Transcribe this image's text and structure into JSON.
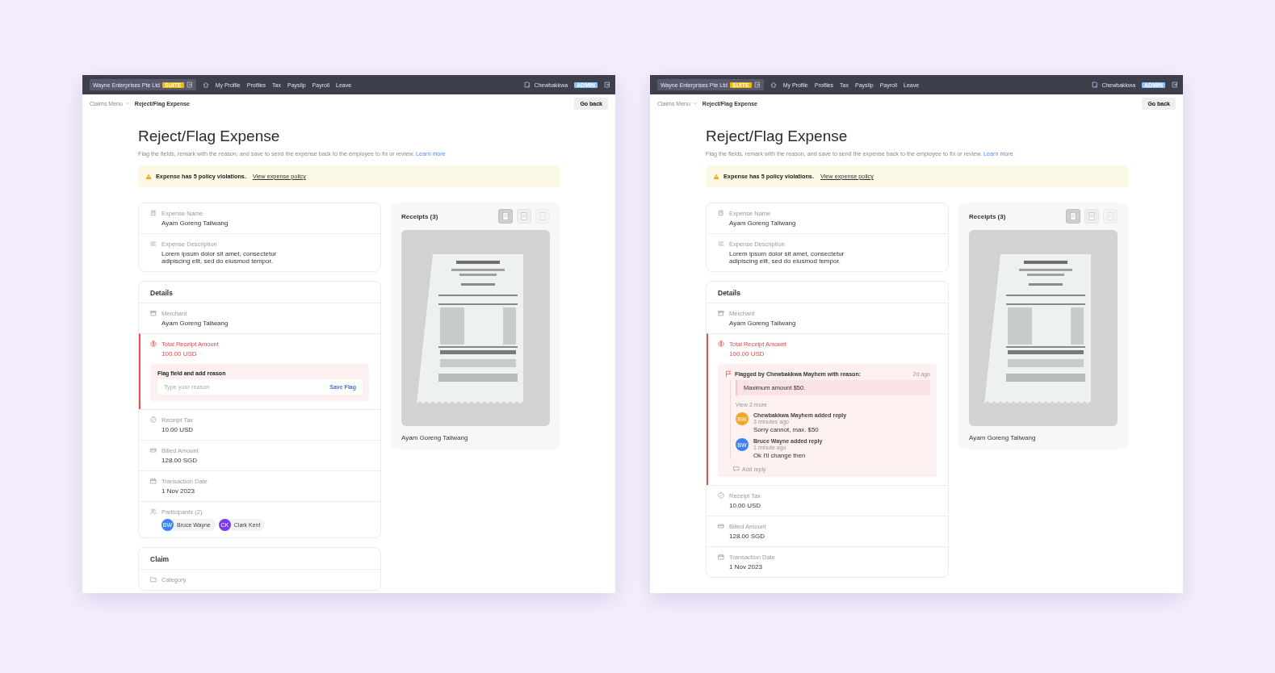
{
  "screens": [
    {
      "nav": {
        "company": "Wayne Enterprises Pte Ltd",
        "company_badge": "SUITE",
        "menu": [
          {
            "label": "My Profile"
          },
          {
            "label": "Profiles"
          },
          {
            "label": "Tax"
          },
          {
            "label": "Payslip"
          },
          {
            "label": "Payroll"
          },
          {
            "label": "Leave"
          }
        ],
        "user": "Chewbakkwa",
        "user_badge": "ADMIN"
      },
      "breadcrumb": {
        "parent": "Claims Menu",
        "current": "Reject/Flag Expense"
      },
      "back_button": "Go back",
      "title": "Reject/Flag Expense",
      "description": "Flag the fields, remark with the reason, and save to send the expense back to the employee to fix or review.",
      "learn_more": "Learn more",
      "alert": {
        "text": "Expense has 5 policy violations.",
        "link": "View expense policy"
      },
      "expense_card": {
        "fields": [
          {
            "label": "Expense Name",
            "value": "Ayam Goreng Taliwang"
          },
          {
            "label": "Expense Description",
            "value": "Lorem ipsum dolor sit amet, consectetur adipiscing elit, sed do eiusmod tempor."
          }
        ]
      },
      "details": {
        "title": "Details",
        "fields": [
          {
            "kind": "text",
            "label": "Merchant",
            "value": "Ayam Goreng Taliwang",
            "flagged": false
          },
          {
            "kind": "flag_form",
            "label": "Total Receipt Amount",
            "value": "100.00 USD",
            "flagged": true,
            "flag_form": {
              "title": "Flag field and add reason",
              "placeholder": "Type your reason",
              "button": "Save Flag"
            }
          },
          {
            "kind": "text",
            "label": "Receipt Tax",
            "value": "10.00 USD",
            "flagged": false
          },
          {
            "kind": "text",
            "label": "Billed Amount",
            "value": "128.00 SGD",
            "flagged": false
          },
          {
            "kind": "text",
            "label": "Transaction Date",
            "value": "1 Nov 2023",
            "flagged": false
          },
          {
            "kind": "participants",
            "label": "Participants (2)",
            "flagged": false,
            "participants": [
              {
                "initials": "BW",
                "name": "Bruce Wayne",
                "color": "#3b82f6"
              },
              {
                "initials": "CK",
                "name": "Clark Kent",
                "color": "#7c3aed"
              }
            ]
          }
        ]
      },
      "claim": {
        "title": "Claim",
        "fields": [
          {
            "label": "Category",
            "flagged": false
          }
        ]
      },
      "receipts": {
        "title": "Receipts (3)",
        "thumbnails": [
          {
            "selected": true
          },
          {
            "selected": false
          },
          {
            "selected": false
          }
        ],
        "caption": "Ayam Goreng Taliwang"
      }
    },
    {
      "nav": {
        "company": "Wayne Enterprises Pte Ltd",
        "company_badge": "SUITE",
        "menu": [
          {
            "label": "My Profile"
          },
          {
            "label": "Profiles"
          },
          {
            "label": "Tax"
          },
          {
            "label": "Payslip"
          },
          {
            "label": "Payroll"
          },
          {
            "label": "Leave"
          }
        ],
        "user": "Chewbakkwa",
        "user_badge": "ADMIN"
      },
      "breadcrumb": {
        "parent": "Claims Menu",
        "current": "Reject/Flag Expense"
      },
      "back_button": "Go back",
      "title": "Reject/Flag Expense",
      "description": "Flag the fields, remark with the reason, and save to send the expense back to the employee to fix or review.",
      "learn_more": "Learn more",
      "alert": {
        "text": "Expense has 5 policy violations.",
        "link": "View expense policy"
      },
      "expense_card": {
        "fields": [
          {
            "label": "Expense Name",
            "value": "Ayam Goreng Taliwang"
          },
          {
            "label": "Expense Description",
            "value": "Lorem ipsum dolor sit amet, consectetur adipiscing elit, sed do eiusmod tempor."
          }
        ]
      },
      "details": {
        "title": "Details",
        "fields": [
          {
            "kind": "text",
            "label": "Merchant",
            "value": "Ayam Goreng Taliwang",
            "flagged": false
          },
          {
            "kind": "flag_thread",
            "label": "Total Receipt Amount",
            "value": "100.00 USD",
            "flagged": true,
            "thread": {
              "author_line": "Flagged by Chewbakkwa Mayhem with reason:",
              "time": "2d ago",
              "reason": "Maximum amount $50.",
              "more": "View 2 more",
              "replies": [
                {
                  "initials": "BW",
                  "color": "#f5a623",
                  "title": "Chewbakkwa Mayhem added reply",
                  "time": "3 minutes ago",
                  "text": "Sorry cannot, max. $50"
                },
                {
                  "initials": "BW",
                  "color": "#3b82f6",
                  "title": "Bruce Wayne added reply",
                  "time": "1 minute ago",
                  "text": "Ok I'll change then"
                }
              ],
              "add_reply": "Add reply"
            }
          },
          {
            "kind": "text",
            "label": "Receipt Tax",
            "value": "10.00 USD",
            "flagged": false
          },
          {
            "kind": "text",
            "label": "Billed Amount",
            "value": "128.00 SGD",
            "flagged": false
          },
          {
            "kind": "text",
            "label": "Transaction Date",
            "value": "1 Nov 2023",
            "flagged": false
          }
        ]
      },
      "receipts": {
        "title": "Receipts (3)",
        "thumbnails": [
          {
            "selected": true
          },
          {
            "selected": false
          },
          {
            "selected": false
          }
        ],
        "caption": "Ayam Goreng Taliwang"
      }
    }
  ]
}
